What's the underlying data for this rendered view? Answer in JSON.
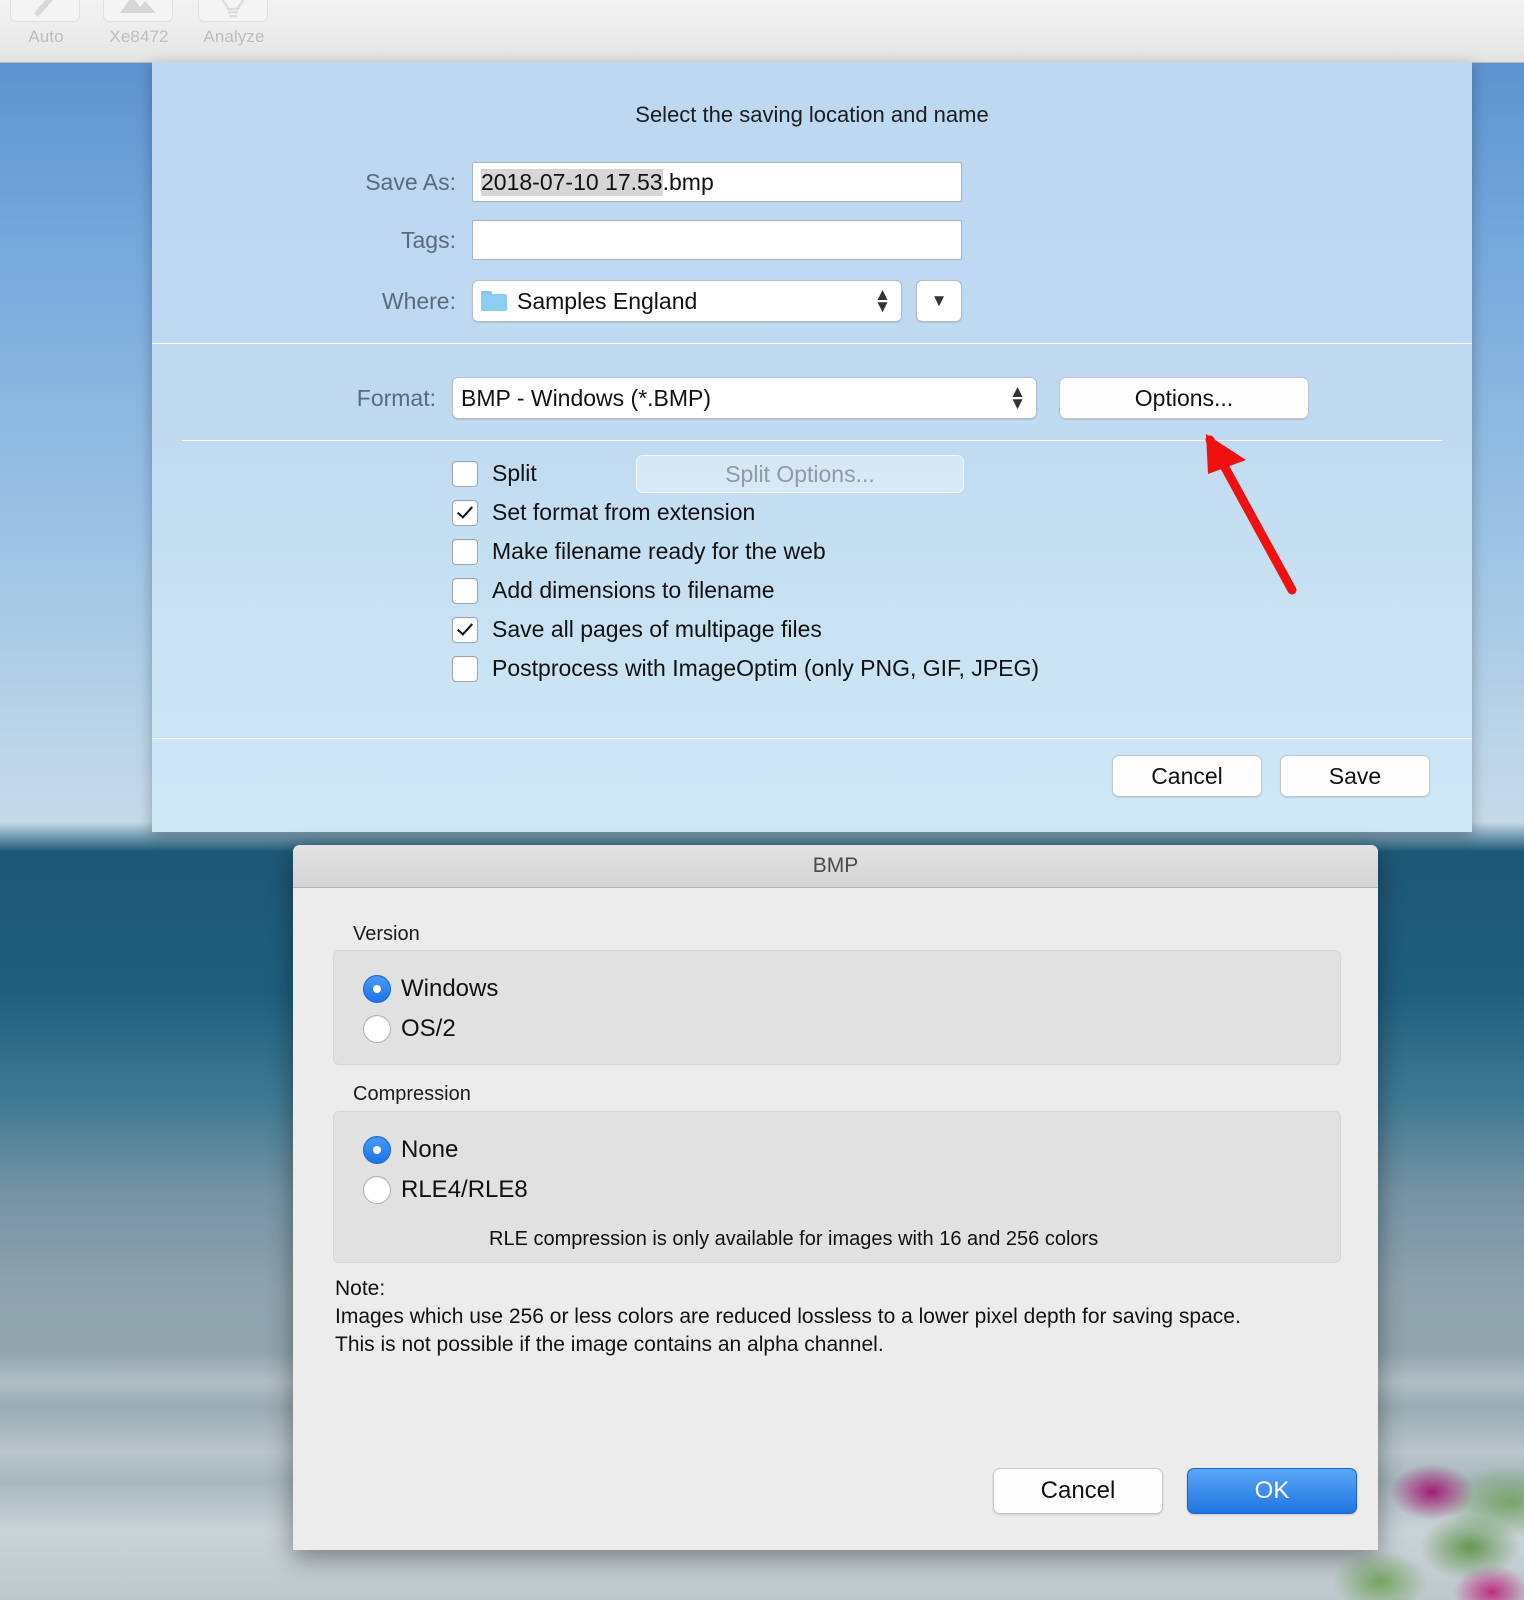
{
  "toolbar": {
    "items": [
      {
        "label": "Auto",
        "icon": "wand-icon"
      },
      {
        "label": "Xe8472",
        "icon": "image-icon"
      },
      {
        "label": "Analyze",
        "icon": "lightbulb-icon"
      }
    ]
  },
  "save_sheet": {
    "title": "Select the saving location and name",
    "save_as": {
      "label": "Save As:",
      "value_selected": "2018-07-10 17.53",
      "value_rest": ".bmp"
    },
    "tags": {
      "label": "Tags:",
      "value": "",
      "placeholder": ""
    },
    "where": {
      "label": "Where:",
      "value": "Samples England",
      "folder_icon": "folder-icon",
      "stepper_icon": "up-down-stepper-icon",
      "chevron_icon": "chevron-down-icon"
    },
    "format": {
      "label": "Format:",
      "value": "BMP - Windows (*.BMP)",
      "options_button": "Options..."
    },
    "checkboxes": [
      {
        "label": "Split",
        "checked": false
      },
      {
        "label": "Set format from extension",
        "checked": true
      },
      {
        "label": "Make filename ready for the web",
        "checked": false
      },
      {
        "label": "Add dimensions to filename",
        "checked": false
      },
      {
        "label": "Save all pages of multipage files",
        "checked": true
      },
      {
        "label": "Postprocess with ImageOptim (only PNG, GIF, JPEG)",
        "checked": false
      }
    ],
    "split_options_button": "Split Options...",
    "cancel_button": "Cancel",
    "save_button": "Save"
  },
  "bmp_dialog": {
    "title": "BMP",
    "version": {
      "group_label": "Version",
      "options": [
        {
          "label": "Windows",
          "selected": true
        },
        {
          "label": "OS/2",
          "selected": false
        }
      ]
    },
    "compression": {
      "group_label": "Compression",
      "options": [
        {
          "label": "None",
          "selected": true
        },
        {
          "label": "RLE4/RLE8",
          "selected": false
        }
      ],
      "hint": "RLE compression is only available for images with 16 and 256 colors"
    },
    "note": {
      "heading": "Note:",
      "line1": "Images which use 256 or less colors are reduced lossless to a lower pixel depth for saving space.",
      "line2": "This is not possible if the image contains an alpha channel."
    },
    "cancel_button": "Cancel",
    "ok_button": "OK"
  },
  "annotation": {
    "arrow": "red-arrow-pointing-to-options-button",
    "color": "#f11010"
  },
  "colors": {
    "sheet_background": "#bdd8f1",
    "dialog_background": "#ececec",
    "accent_blue": "#1a73e8",
    "annotation_red": "#f11010"
  }
}
